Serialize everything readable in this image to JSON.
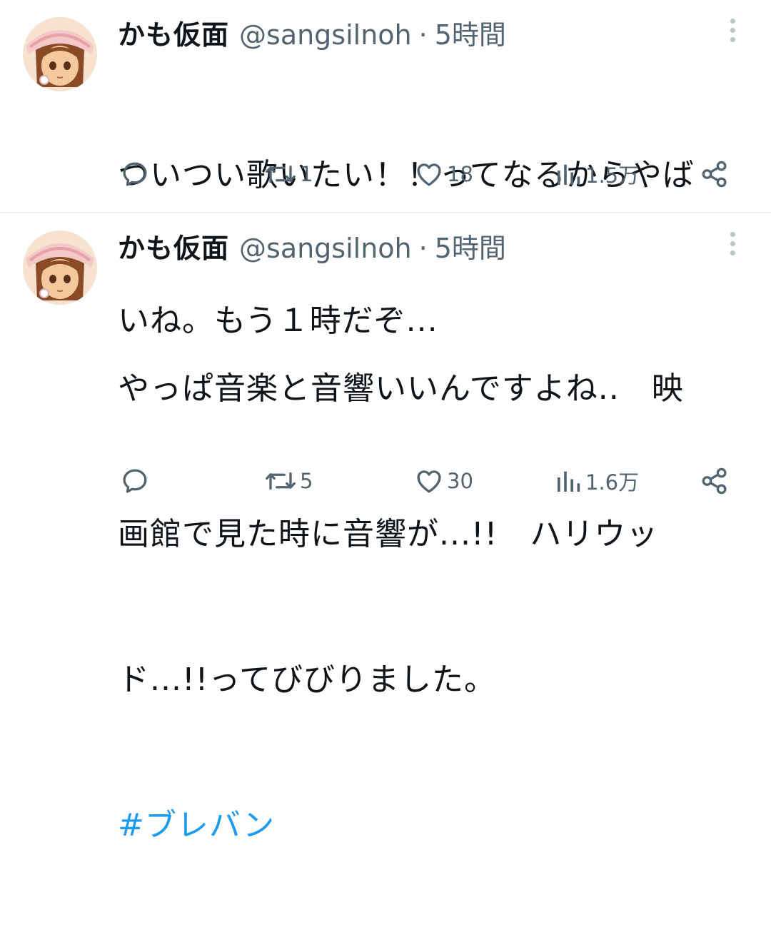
{
  "tweets": [
    {
      "author": "かも仮面",
      "handle": "@sangsilnoh",
      "separator": "·",
      "time": "5時間",
      "lines": [
        "ついつい歌いたい！！ってなるからやば",
        "いね。もう１時だぞ..."
      ],
      "hashtag": "",
      "reply_count": "",
      "retweets": "1",
      "likes": "18",
      "views": "1.5万",
      "icons": [
        "more-icon",
        "reply-icon",
        "retweet-icon",
        "like-icon",
        "views-icon",
        "share-icon"
      ]
    },
    {
      "author": "かも仮面",
      "handle": "@sangsilnoh",
      "separator": "·",
      "time": "5時間",
      "lines": [
        "やっぱ音楽と音響いいんですよね..　映",
        "画館で見た時に音響が...!!　ハリウッ",
        "ド...!!ってびびりました。"
      ],
      "hashtag": "#ブレバン",
      "reply_count": "",
      "retweets": "5",
      "likes": "30",
      "views": "1.6万",
      "icons": [
        "more-icon",
        "reply-icon",
        "retweet-icon",
        "like-icon",
        "views-icon",
        "share-icon"
      ]
    }
  ],
  "colors": {
    "text": "#0f1419",
    "secondary": "#536471",
    "link": "#1d9bf0",
    "divider": "#eff3f4"
  }
}
